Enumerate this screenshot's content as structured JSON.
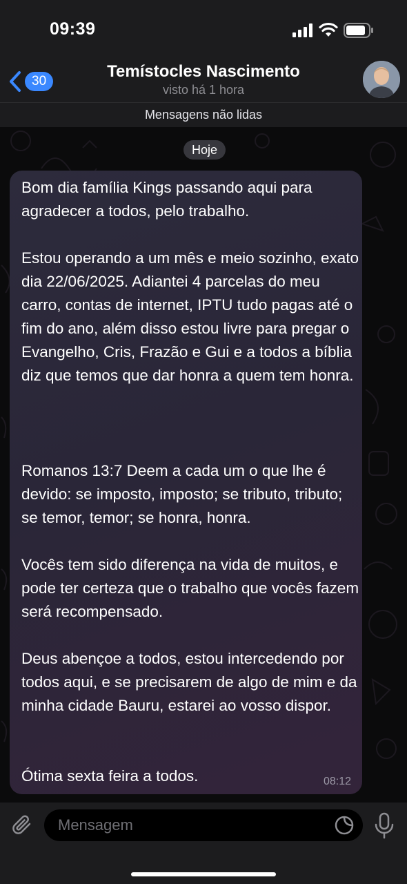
{
  "status_bar": {
    "time": "09:39"
  },
  "header": {
    "back_count": "30",
    "contact_name": "Temístocles Nascimento",
    "contact_status": "visto há 1 hora"
  },
  "unread_banner": "Mensagens não lidas",
  "chat": {
    "date_label": "Hoje",
    "message": {
      "paragraphs": [
        "Bom dia família Kings passando aqui para agradecer a todos, pelo trabalho.",
        "Estou operando a um mês e meio sozinho, exato dia 22/06/2025. Adiantei 4 parcelas do meu carro, contas de internet, IPTU tudo pagas até o fim do ano, além disso estou livre para pregar o Evangelho, Cris, Frazão e Gui e a todos a bíblia diz que temos que dar honra a quem tem honra.",
        "Romanos 13:7 Deem a cada um o que lhe é devido: se imposto, imposto; se tributo, tributo; se temor, temor; se honra, honra.",
        "Vocês tem sido diferença na vida de muitos, e pode ter certeza que o trabalho que vocês fazem será recompensado.",
        "Deus abençoe a todos, estou intercedendo por todos aqui, e se precisarem de algo de mim e da minha cidade Bauru, estarei ao vosso dispor.",
        "Ótima sexta feira a todos."
      ],
      "time": "08:12"
    }
  },
  "composer": {
    "placeholder": "Mensagem"
  },
  "icons": {
    "back": "chevron-left-icon",
    "attach": "paperclip-icon",
    "sticker": "sticker-icon",
    "mic": "microphone-icon"
  },
  "colors": {
    "accent": "#3a88ff",
    "bubble": "#2d2b3c",
    "bar_background": "#1c1c1e"
  }
}
